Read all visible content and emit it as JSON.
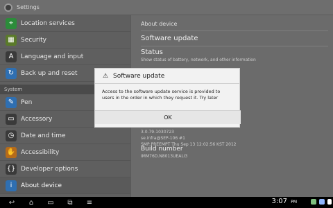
{
  "window": {
    "title": "Settings"
  },
  "sidebar": {
    "items": [
      {
        "label": "Location services",
        "icon": "location-icon",
        "color": "#2c8c3a"
      },
      {
        "label": "Security",
        "icon": "lock-icon",
        "color": "#5a7a2a"
      },
      {
        "label": "Language and input",
        "icon": "keyboard-icon",
        "color": "#3a3a3a"
      },
      {
        "label": "Back up and reset",
        "icon": "backup-icon",
        "color": "#2f6fb1"
      }
    ],
    "section_system": "System",
    "system_items": [
      {
        "label": "Pen",
        "icon": "pen-icon",
        "color": "#2f6fb1"
      },
      {
        "label": "Accessory",
        "icon": "accessory-icon",
        "color": "#3a3a3a"
      },
      {
        "label": "Date and time",
        "icon": "clock-icon",
        "color": "#3a3a3a"
      },
      {
        "label": "Accessibility",
        "icon": "hand-icon",
        "color": "#b56b1a"
      },
      {
        "label": "Developer options",
        "icon": "braces-icon",
        "color": "#3a3a3a"
      },
      {
        "label": "About device",
        "icon": "info-icon",
        "color": "#2f6fb1"
      }
    ]
  },
  "right": {
    "header": "About device",
    "software_update": "Software update",
    "status_title": "Status",
    "status_subtitle": "Show status of battery, network, and other information",
    "build_text_lines": [
      "3.0.79-1030723",
      "se.infra@SEP-106 #1",
      "SMP PREEMPT Thu Sep 13 12:02:56 KST 2012"
    ],
    "build_number_title": "Build number",
    "build_number_value": "IMM76D.N8013UEALI3"
  },
  "dialog": {
    "title": "Software update",
    "message": "Access to the software update service is provided to users in the order in which they request it. Try later",
    "ok_label": "OK"
  },
  "navbar": {
    "clock": "3:07",
    "clock_suffix": "PM"
  }
}
